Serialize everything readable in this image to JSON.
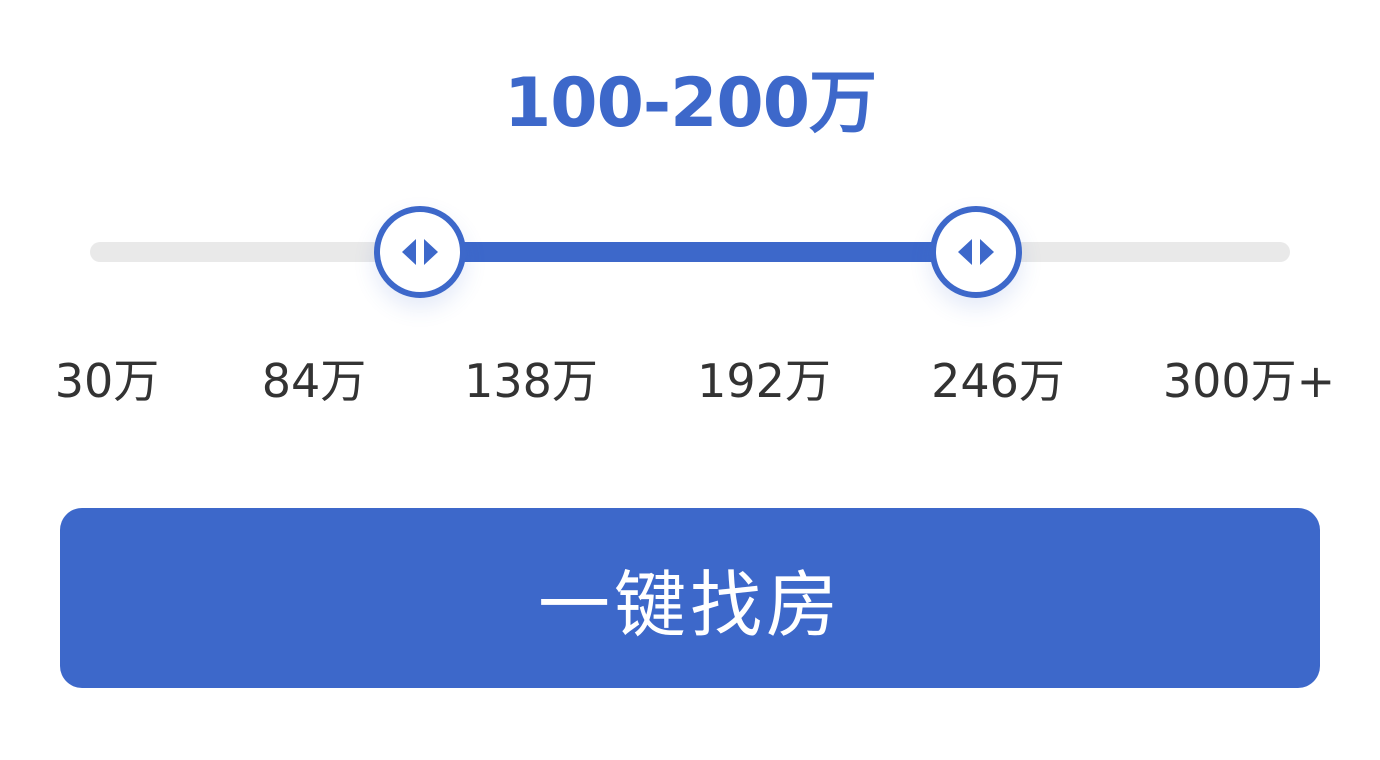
{
  "price_filter": {
    "selected_range_label": "100-200万",
    "min_value": 30,
    "max_value": 300,
    "selected_low": 100,
    "selected_high": 200,
    "tick_labels": [
      "30万",
      "84万",
      "138万",
      "192万",
      "246万",
      "300万+"
    ]
  },
  "search_button": {
    "label": "一键找房"
  },
  "colors": {
    "accent": "#3d68ca",
    "track_inactive": "#e9e9e9",
    "text_dark": "#333333",
    "button_text": "#ffffff",
    "background": "#ffffff"
  },
  "icons": {
    "handle_icon": "left-right-arrows-icon"
  }
}
